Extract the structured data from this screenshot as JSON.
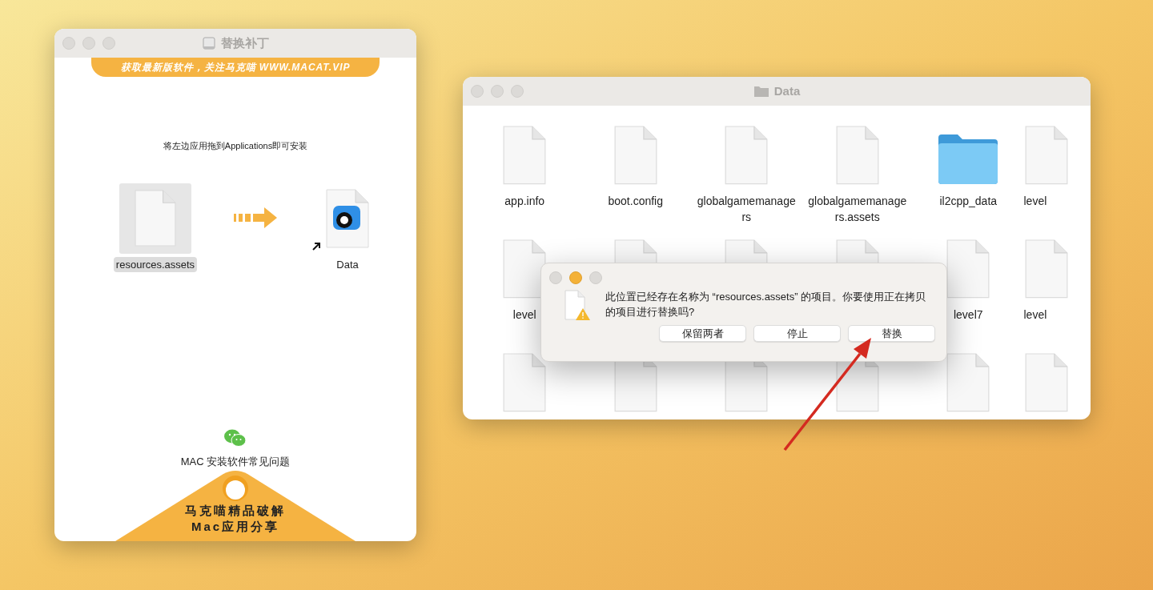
{
  "installer_window": {
    "title": "替换补丁",
    "banner": "获取最新版软件，关注马克喵 WWW.MACAT.VIP",
    "instruction": "将左边应用拖到Applications即可安装",
    "source_item": {
      "name": "resources.assets",
      "selected": true
    },
    "target_item": {
      "name": "Data"
    },
    "faq_link": "MAC 安装软件常见问题",
    "promo_lines": [
      "马克喵精品破解",
      "Mac应用分享"
    ]
  },
  "finder_window": {
    "title": "Data",
    "rows": [
      [
        {
          "kind": "file",
          "name": "app.info"
        },
        {
          "kind": "file",
          "name": "boot.config"
        },
        {
          "kind": "file",
          "name": "globalgamemanagers"
        },
        {
          "kind": "file",
          "name": "globalgamemanagers.assets"
        },
        {
          "kind": "folder",
          "name": "il2cpp_data"
        },
        {
          "kind": "file",
          "name": "level"
        }
      ],
      [
        {
          "kind": "file",
          "name": "level"
        },
        {
          "kind": "file"
        },
        {
          "kind": "file"
        },
        {
          "kind": "file"
        },
        {
          "kind": "file",
          "name": "level7"
        },
        {
          "kind": "file",
          "name": "level"
        }
      ],
      [
        {
          "kind": "file"
        },
        {
          "kind": "file"
        },
        {
          "kind": "file"
        },
        {
          "kind": "file"
        },
        {
          "kind": "file"
        },
        {
          "kind": "file"
        }
      ]
    ]
  },
  "dialog": {
    "message": "此位置已经存在名称为 “resources.assets” 的项目。你要使用正在拷贝的项目进行替换吗?",
    "buttons": [
      "保留两者",
      "停止",
      "替换"
    ]
  }
}
